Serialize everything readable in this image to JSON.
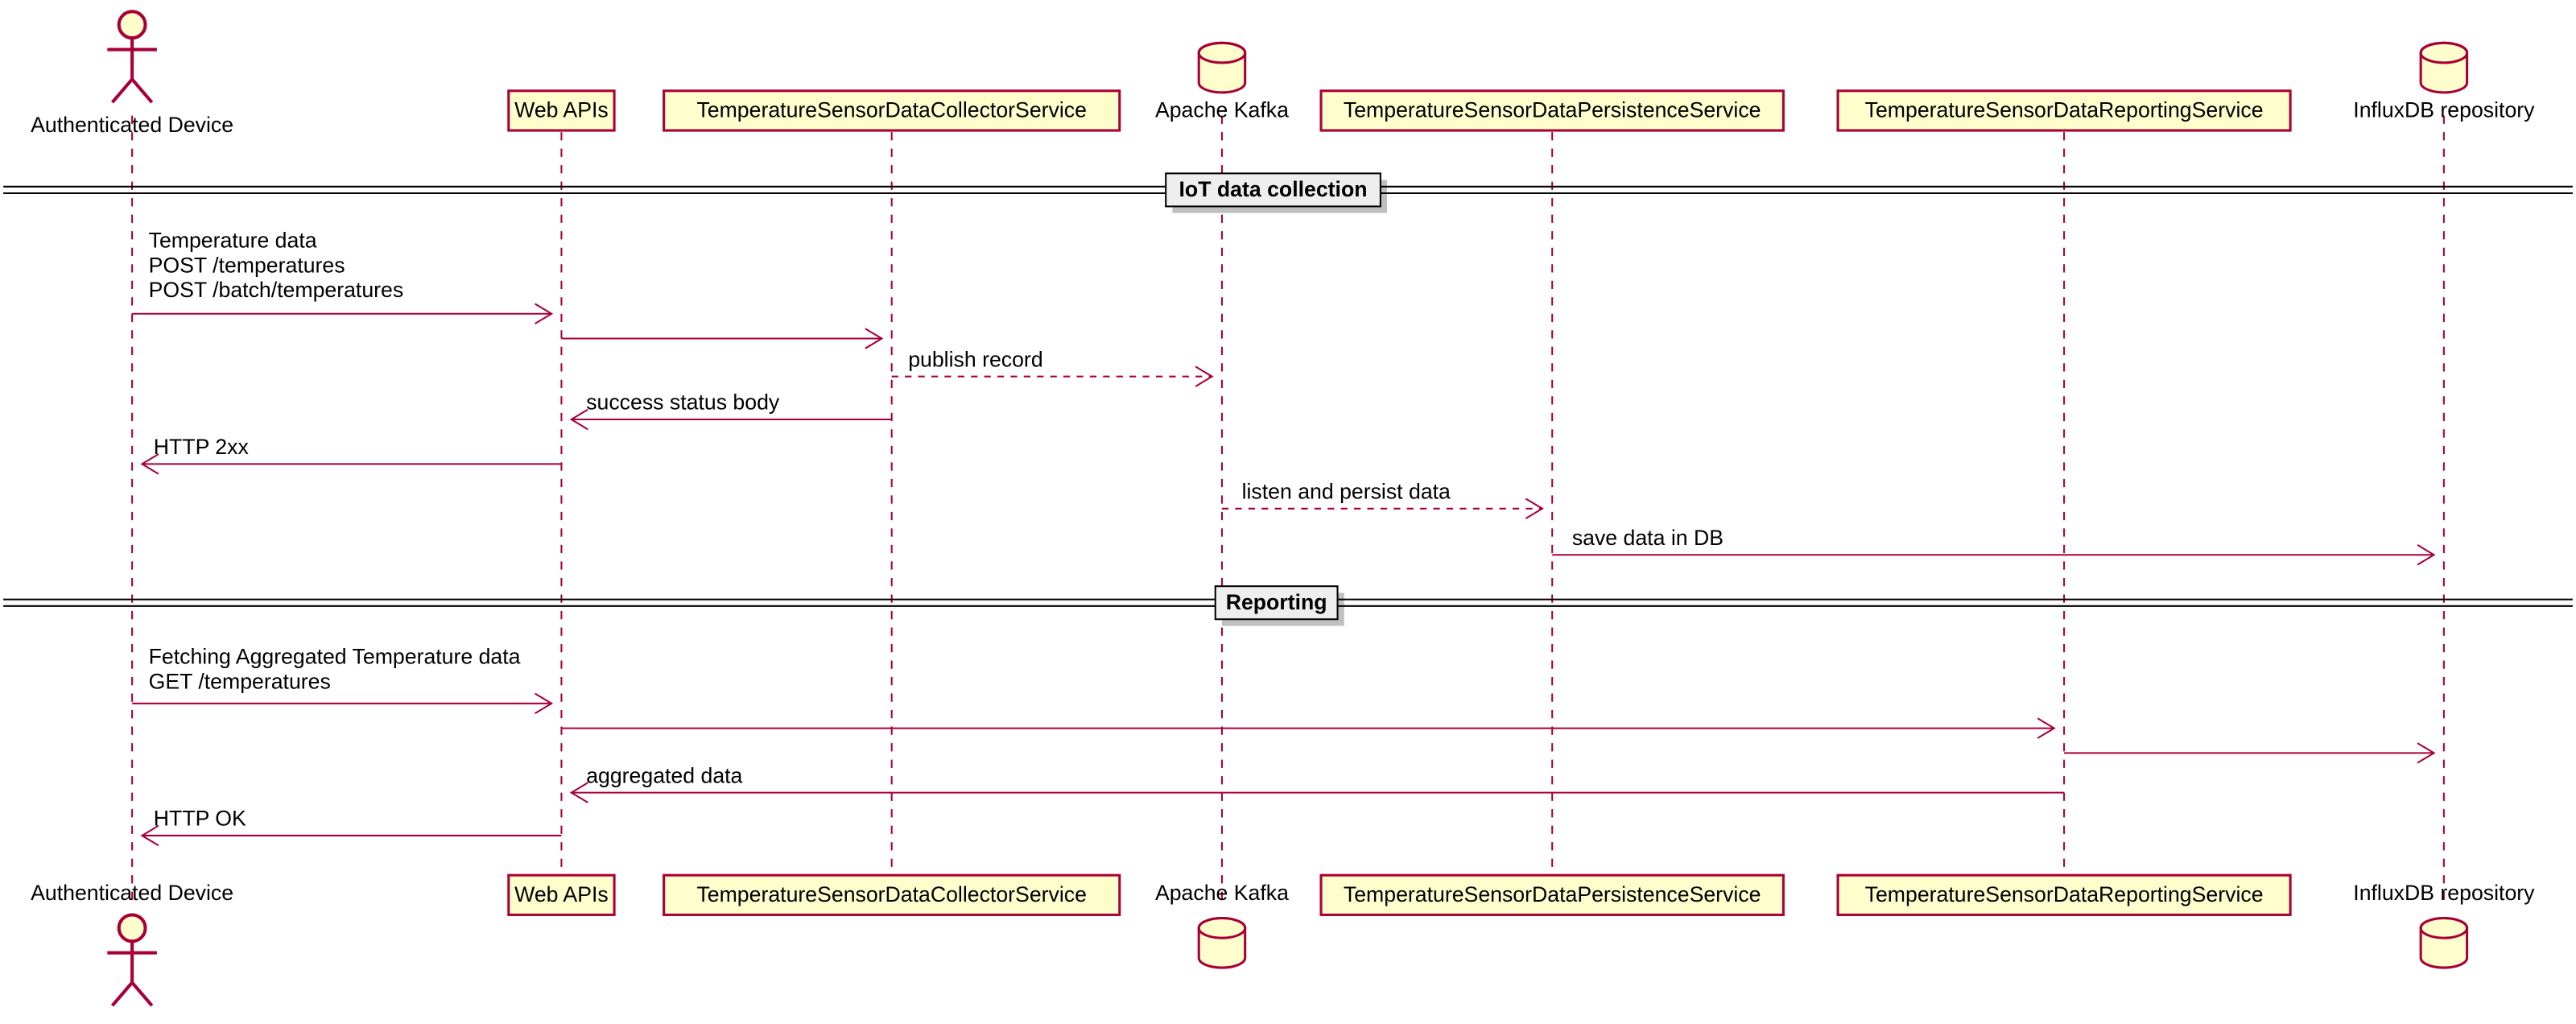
{
  "participants": {
    "actor": "Authenticated Device",
    "webapi": "Web APIs",
    "collector": "TemperatureSensorDataCollectorService",
    "kafka": "Apache Kafka",
    "persistence": "TemperatureSensorDataPersistenceService",
    "reporting": "TemperatureSensorDataReportingService",
    "influx": "InfluxDB repository"
  },
  "dividers": {
    "collection": "IoT data collection",
    "reporting": "Reporting"
  },
  "messages": {
    "m1a": "Temperature data",
    "m1b": "POST /temperatures",
    "m1c": "POST /batch/temperatures",
    "m3": "publish record",
    "m4": "success status body",
    "m5": "HTTP 2xx",
    "m6": "listen and persist data",
    "m7": "save data in DB",
    "m8a": "Fetching Aggregated Temperature data",
    "m8b": "GET /temperatures",
    "m11": "aggregated data",
    "m12": "HTTP OK"
  }
}
